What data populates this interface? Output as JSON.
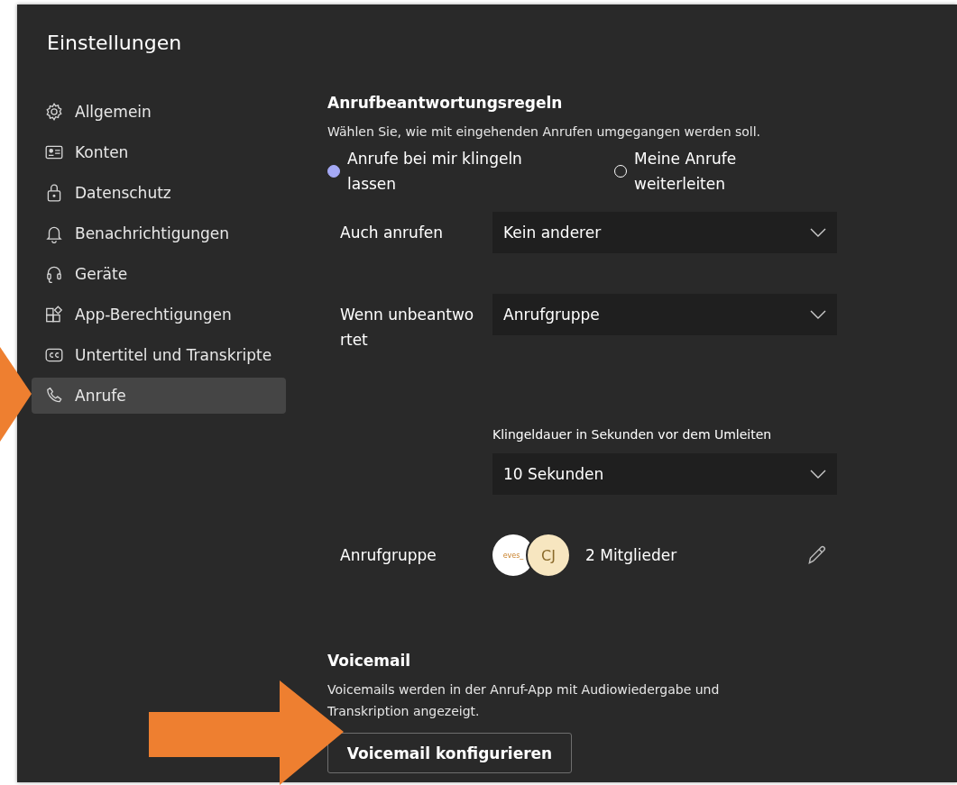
{
  "window": {
    "title": "Einstellungen"
  },
  "sidebar": {
    "items": [
      {
        "label": "Allgemein",
        "kind": "gear",
        "selected": false
      },
      {
        "label": "Konten",
        "kind": "card",
        "selected": false
      },
      {
        "label": "Datenschutz",
        "kind": "lock",
        "selected": false
      },
      {
        "label": "Benachrichtigungen",
        "kind": "bell",
        "selected": false
      },
      {
        "label": "Geräte",
        "kind": "headset",
        "selected": false
      },
      {
        "label": "App-Berechtigungen",
        "kind": "apps",
        "selected": false
      },
      {
        "label": "Untertitel und Transkripte",
        "kind": "cc",
        "selected": false
      },
      {
        "label": "Anrufe",
        "kind": "phone",
        "selected": true
      }
    ]
  },
  "answer_rules": {
    "heading": "Anrufbeantwortungsregeln",
    "description": "Wählen Sie, wie mit eingehenden Anrufen umgegangen werden soll.",
    "options": [
      {
        "label": "Anrufe bei mir klingeln lassen",
        "selected": true
      },
      {
        "label": "Meine Anrufe weiterleiten",
        "selected": false
      }
    ],
    "also_ring": {
      "label": "Auch anrufen",
      "value": "Kein anderer"
    },
    "unanswered": {
      "label": "Wenn unbeantwortet",
      "value": "Anrufgruppe"
    },
    "ring_duration": {
      "caption": "Klingeldauer in Sekunden vor dem Umleiten",
      "value": "10 Sekunden"
    },
    "call_group": {
      "label": "Anrufgruppe",
      "avatars": [
        {
          "kind": "logo",
          "text": "eves_"
        },
        {
          "kind": "initials",
          "text": "CJ"
        }
      ],
      "members": "2 Mitglieder"
    }
  },
  "voicemail": {
    "heading": "Voicemail",
    "description": "Voicemails werden in der Anruf-App mit Audiowiedergabe und Transkription angezeigt.",
    "button": "Voicemail konfigurieren"
  }
}
